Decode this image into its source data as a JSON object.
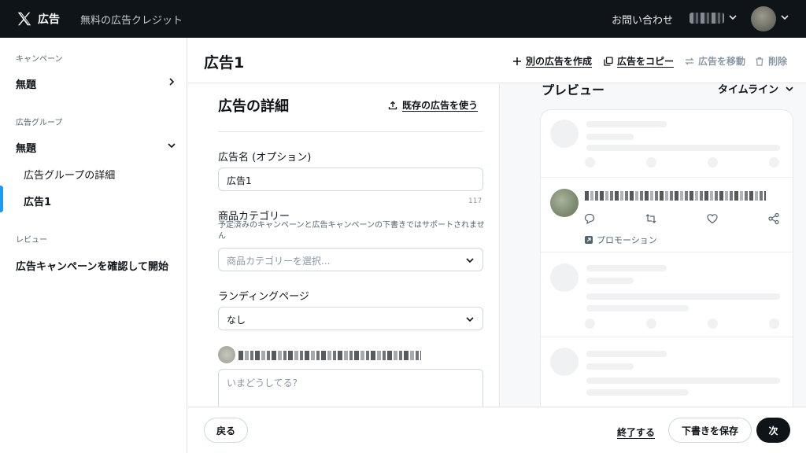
{
  "topbar": {
    "brand": "広告",
    "credit_link": "無料の広告クレジット",
    "contact_link": "お問い合わせ"
  },
  "sidebar": {
    "campaign_section": "キャンペーン",
    "campaign_name": "無題",
    "adgroup_section": "広告グループ",
    "adgroup_name": "無題",
    "adgroup_details": "広告グループの詳細",
    "ad_item": "広告1",
    "review_section": "レビュー",
    "review_item": "広告キャンペーンを確認して開始"
  },
  "header": {
    "title": "広告1",
    "create_another": "別の広告を作成",
    "copy_ad": "広告をコピー",
    "move_ad": "広告を移動",
    "delete": "削除"
  },
  "form": {
    "title": "広告の詳細",
    "use_existing": "既存の広告を使う",
    "ad_name_label": "広告名 (オプション)",
    "ad_name_value": "広告1",
    "ad_name_counter": "117",
    "category_label": "商品カテゴリー",
    "category_help": "予定済みのキャンペーンと広告キャンペーンの下書きではサポートされません",
    "category_placeholder": "商品カテゴリーを選択...",
    "landing_label": "ランディングページ",
    "landing_value": "なし",
    "post_placeholder": "いまどうしてる?"
  },
  "preview": {
    "title": "プレビュー",
    "placement": "タイムライン",
    "promo_label": "プロモーション"
  },
  "footer": {
    "back": "戻る",
    "finish": "終了する",
    "save_draft": "下書きを保存",
    "next": "次"
  },
  "colors": {
    "topbar_bg": "#0f1419",
    "accent": "#1d9bf0",
    "primary_button": "#0f1419"
  }
}
